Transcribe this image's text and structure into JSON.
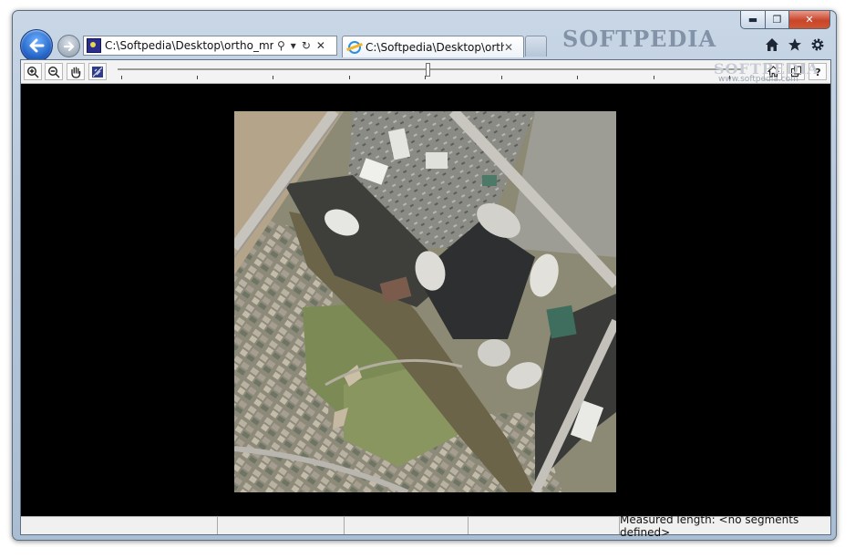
{
  "window": {
    "caption_buttons": {
      "minimize": "▬",
      "maximize": "❐",
      "close": "✕"
    },
    "brand": "SOFTPEDIA",
    "brand_url": "www.softpedia.com"
  },
  "navigation": {
    "back_icon": "back-arrow-icon",
    "forward_icon": "forward-arrow-icon",
    "address": "C:\\Softpedia\\Desktop\\ortho_mrsid",
    "address_buttons": [
      "⚲",
      "▾",
      "↻",
      "✕"
    ]
  },
  "tabs": [
    {
      "label": "C:\\Softpedia\\Desktop\\orth...",
      "icon": "ie-icon",
      "close": "✕"
    }
  ],
  "browser_icons": [
    "home-icon",
    "favorites-star-icon",
    "tools-gear-icon"
  ],
  "viewer_toolbar": {
    "left_tools": [
      "zoom-in-icon",
      "zoom-out-icon",
      "pan-hand-icon",
      "measure-icon"
    ],
    "right_tools": [
      "home-icon",
      "copy-icon",
      "help-icon"
    ],
    "zoom_slider_position": 0.5
  },
  "image": {
    "description_icon": "aerial-orthophoto"
  },
  "statusbar": {
    "measured_length": "Measured length: <no segments defined>"
  },
  "colors": {
    "close_button": "#c8452b",
    "back_button": "#2463c6",
    "viewer_bg": "#000000"
  }
}
